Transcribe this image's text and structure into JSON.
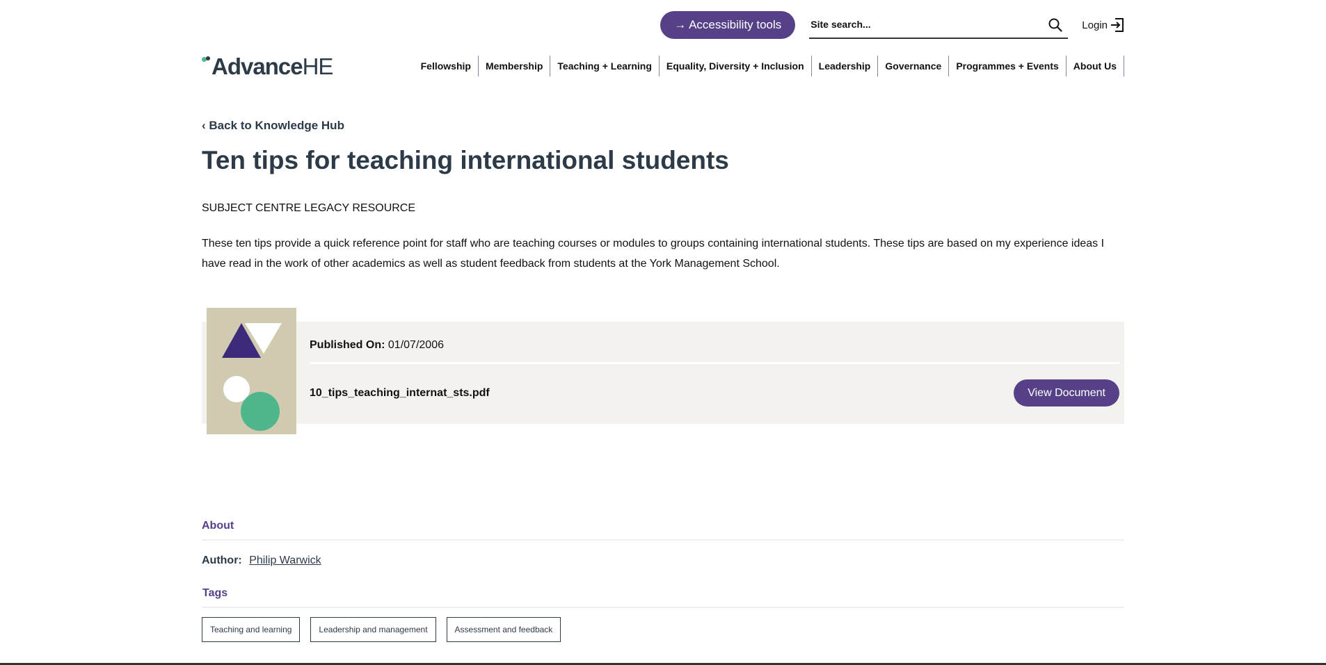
{
  "header": {
    "accessibility_label": "→ Accessibility tools",
    "search_placeholder": "Site search...",
    "login_label": "Login",
    "logo": {
      "bold": "Advance",
      "light": "HE"
    }
  },
  "nav": {
    "items": [
      "Fellowship",
      "Membership",
      "Teaching + Learning",
      "Equality, Diversity + Inclusion",
      "Leadership",
      "Governance",
      "Programmes + Events",
      "About Us"
    ]
  },
  "page": {
    "back_link": "‹ Back to Knowledge Hub",
    "title": "Ten tips for teaching international students",
    "resource_type": "SUBJECT CENTRE LEGACY RESOURCE",
    "description": "These ten tips provide a quick reference point for staff who are teaching courses or modules to groups containing international students. These tips are based on my experience ideas I have read in the work of other academics as well as student feedback from students at the York Management School."
  },
  "document": {
    "published_label": "Published On:",
    "published_date": "01/07/2006",
    "filename": "10_tips_teaching_internat_sts.pdf",
    "view_label": "View Document"
  },
  "about": {
    "heading": "About",
    "author_label": "Author:",
    "author_name": "Philip Warwick"
  },
  "tags": {
    "heading": "Tags",
    "items": [
      "Teaching and learning",
      "Leadership and management",
      "Assessment and feedback"
    ]
  },
  "colors": {
    "accent": "#564188",
    "text_dark": "#2d3a48",
    "card_bg": "#f3f2ef",
    "thumb_bg": "#cfcab0",
    "green": "#4fb58a"
  }
}
